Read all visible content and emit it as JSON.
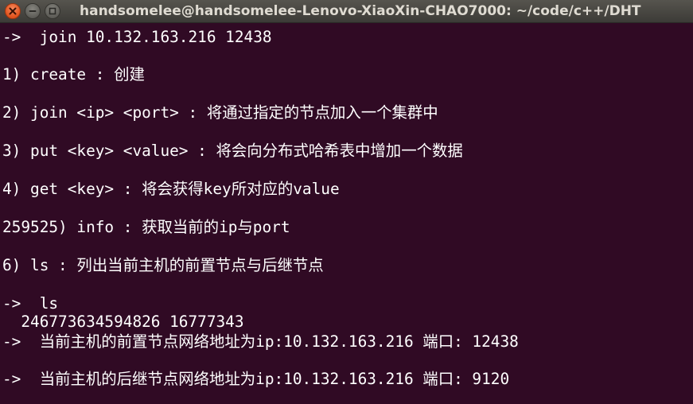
{
  "window": {
    "title": "handsomelee@handsomelee-Lenovo-XiaoXin-CHAO7000: ~/code/c++/DHT",
    "colors": {
      "terminal_bg": "#300a24",
      "titlebar_bg": "#3c3b37",
      "close_button": "#e95420",
      "text": "#ffffff"
    },
    "buttons": {
      "close_icon": "close-icon",
      "minimize_icon": "minimize-icon",
      "maximize_icon": "maximize-icon"
    }
  },
  "terminal": {
    "lines": [
      "->  join 10.132.163.216 12438",
      "1) create : 创建",
      "2) join <ip> <port> : 将通过指定的节点加入一个集群中",
      "3) put <key> <value> : 将会向分布式哈希表中增加一个数据",
      "4) get <key> : 将会获得key所对应的value",
      "259525) info : 获取当前的ip与port",
      "6) ls : 列出当前主机的前置节点与后继节点",
      "->  ls",
      "  246773634594826 16777343",
      "->  当前主机的前置节点网络地址为ip:10.132.163.216 端口: 12438",
      "->  当前主机的后继节点网络地址为ip:10.132.163.216 端口: 9120"
    ]
  }
}
